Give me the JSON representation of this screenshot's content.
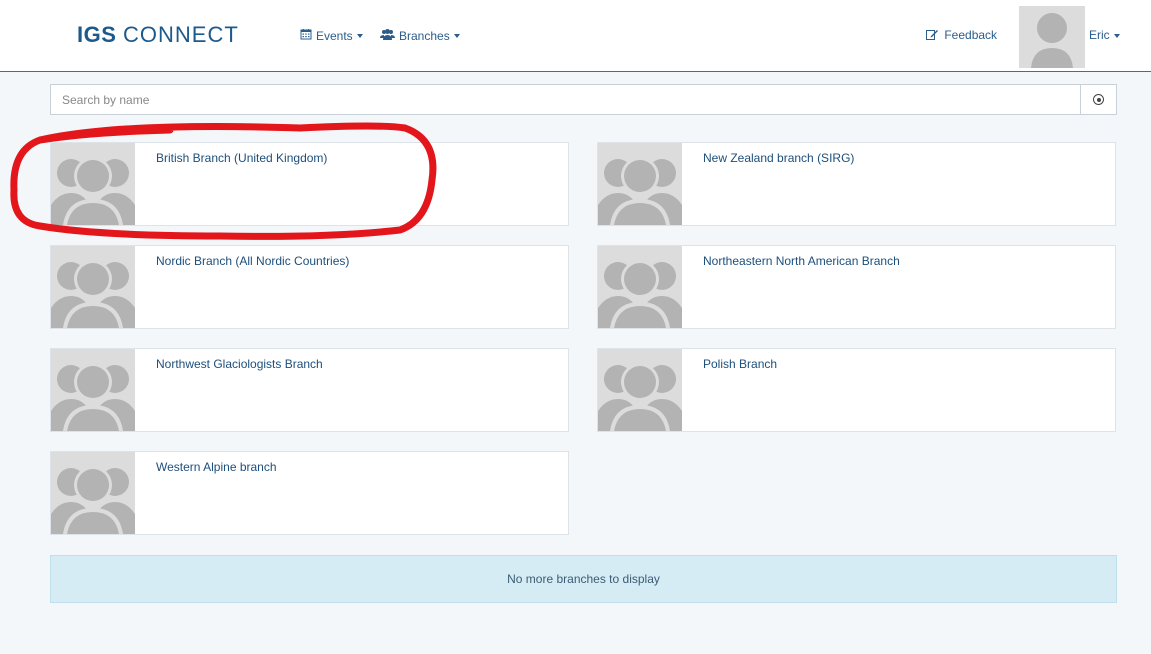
{
  "header": {
    "logo_bold": "IGS",
    "logo_rest": "CONNECT",
    "nav": [
      {
        "label": "Events",
        "icon": "calendar-icon"
      },
      {
        "label": "Branches",
        "icon": "users-icon"
      }
    ],
    "feedback_label": "Feedback",
    "user_name": "Eric"
  },
  "search": {
    "placeholder": "Search by name",
    "value": ""
  },
  "branches": [
    {
      "name": "British Branch (United Kingdom)"
    },
    {
      "name": "New Zealand branch (SIRG)"
    },
    {
      "name": "Nordic Branch (All Nordic Countries)"
    },
    {
      "name": "Northeastern North American Branch"
    },
    {
      "name": "Northwest Glaciologists Branch"
    },
    {
      "name": "Polish Branch"
    },
    {
      "name": "Western Alpine branch"
    }
  ],
  "notice": "No more branches to display",
  "colors": {
    "brand": "#1d5a8c",
    "link": "#1d4f7c",
    "notice_bg": "#d6ecf5",
    "annotation": "#e3161b"
  }
}
